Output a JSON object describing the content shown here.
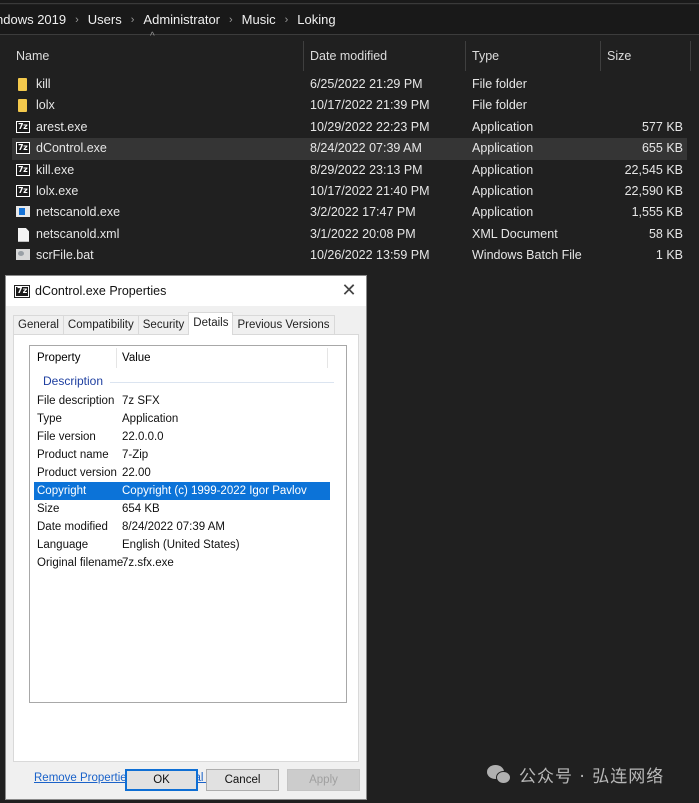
{
  "explorer": {
    "breadcrumb": [
      "ndows 2019",
      "Users",
      "Administrator",
      "Music",
      "Loking"
    ],
    "breadcrumb_separator": "›",
    "columns": {
      "name": "Name",
      "date": "Date modified",
      "type": "Type",
      "size": "Size"
    },
    "sort_indicator": "^",
    "files": [
      {
        "icon": "folder-icon",
        "name": "kill",
        "date": "6/25/2022 21:29 PM",
        "type": "File folder",
        "size": ""
      },
      {
        "icon": "folder-icon",
        "name": "lolx",
        "date": "10/17/2022 21:39 PM",
        "type": "File folder",
        "size": ""
      },
      {
        "icon": "7zip-exe-icon",
        "name": "arest.exe",
        "date": "10/29/2022 22:23 PM",
        "type": "Application",
        "size": "577 KB"
      },
      {
        "icon": "7zip-exe-icon",
        "name": "dControl.exe",
        "date": "8/24/2022 07:39 AM",
        "type": "Application",
        "size": "655 KB",
        "selected": true
      },
      {
        "icon": "7zip-exe-icon",
        "name": "kill.exe",
        "date": "8/29/2022 23:13 PM",
        "type": "Application",
        "size": "22,545 KB"
      },
      {
        "icon": "7zip-exe-icon",
        "name": "lolx.exe",
        "date": "10/17/2022 21:40 PM",
        "type": "Application",
        "size": "22,590 KB"
      },
      {
        "icon": "application-icon",
        "name": "netscanold.exe",
        "date": "3/2/2022 17:47 PM",
        "type": "Application",
        "size": "1,555 KB"
      },
      {
        "icon": "document-icon",
        "name": "netscanold.xml",
        "date": "3/1/2022 20:08 PM",
        "type": "XML Document",
        "size": "58 KB"
      },
      {
        "icon": "batch-file-icon",
        "name": "scrFile.bat",
        "date": "10/26/2022 13:59 PM",
        "type": "Windows Batch File",
        "size": "1 KB"
      }
    ]
  },
  "dialog": {
    "icon_glyph": "7z",
    "title": "dControl.exe Properties",
    "close_glyph": "✕",
    "tabs": [
      {
        "label": "General",
        "active": false
      },
      {
        "label": "Compatibility",
        "active": false
      },
      {
        "label": "Security",
        "active": false
      },
      {
        "label": "Details",
        "active": true
      },
      {
        "label": "Previous Versions",
        "active": false
      }
    ],
    "details": {
      "header_property": "Property",
      "header_value": "Value",
      "group_label": "Description",
      "rows": [
        {
          "property": "File description",
          "value": "7z SFX"
        },
        {
          "property": "Type",
          "value": "Application"
        },
        {
          "property": "File version",
          "value": "22.0.0.0"
        },
        {
          "property": "Product name",
          "value": "7-Zip"
        },
        {
          "property": "Product version",
          "value": "22.00"
        },
        {
          "property": "Copyright",
          "value": "Copyright (c) 1999-2022 Igor Pavlov",
          "selected": true
        },
        {
          "property": "Size",
          "value": "654 KB"
        },
        {
          "property": "Date modified",
          "value": "8/24/2022 07:39 AM"
        },
        {
          "property": "Language",
          "value": "English (United States)"
        },
        {
          "property": "Original filename",
          "value": "7z.sfx.exe"
        }
      ]
    },
    "remove_link": "Remove Properties and Personal Information",
    "buttons": {
      "ok": "OK",
      "cancel": "Cancel",
      "apply": "Apply"
    }
  },
  "watermark": {
    "text": "公众号 · 弘连网络"
  }
}
